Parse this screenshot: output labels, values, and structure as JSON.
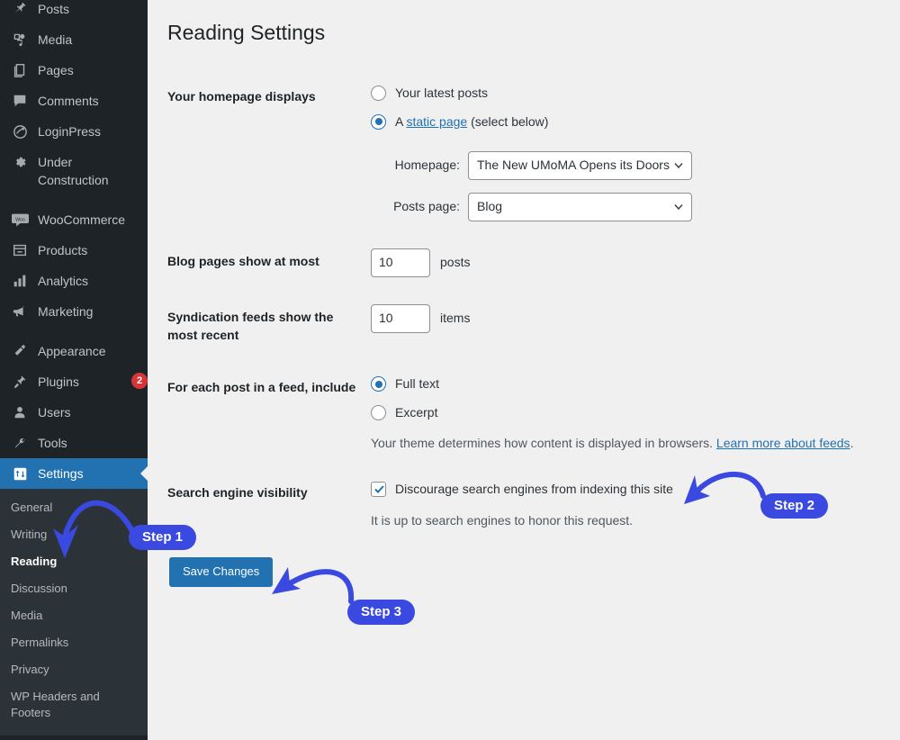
{
  "theme": {
    "sidebar_bg": "#1d2327",
    "submenu_bg": "#2c3338",
    "accent_blue": "#2271b1",
    "annotation_blue": "#3a49e0",
    "badge_red": "#d63638",
    "content_bg": "#f0f0f1"
  },
  "sidebar": {
    "items": [
      {
        "label": "Posts",
        "icon": "pin-icon",
        "active": false
      },
      {
        "label": "Media",
        "icon": "media-icon",
        "active": false
      },
      {
        "label": "Pages",
        "icon": "pages-icon",
        "active": false
      },
      {
        "label": "Comments",
        "icon": "comment-icon",
        "active": false
      },
      {
        "label": "LoginPress",
        "icon": "loginpress-icon",
        "active": false
      },
      {
        "label": "Under Construction",
        "icon": "gear-icon",
        "active": false
      },
      {
        "label": "WooCommerce",
        "icon": "woocommerce-icon",
        "active": false
      },
      {
        "label": "Products",
        "icon": "products-icon",
        "active": false
      },
      {
        "label": "Analytics",
        "icon": "analytics-icon",
        "active": false
      },
      {
        "label": "Marketing",
        "icon": "megaphone-icon",
        "active": false
      },
      {
        "label": "Appearance",
        "icon": "brush-icon",
        "active": false
      },
      {
        "label": "Plugins",
        "icon": "plug-icon",
        "active": false,
        "badge": "2"
      },
      {
        "label": "Users",
        "icon": "user-icon",
        "active": false
      },
      {
        "label": "Tools",
        "icon": "wrench-icon",
        "active": false
      },
      {
        "label": "Settings",
        "icon": "settings-icon",
        "active": true
      }
    ],
    "submenu": [
      {
        "label": "General",
        "current": false
      },
      {
        "label": "Writing",
        "current": false
      },
      {
        "label": "Reading",
        "current": true
      },
      {
        "label": "Discussion",
        "current": false
      },
      {
        "label": "Media",
        "current": false
      },
      {
        "label": "Permalinks",
        "current": false
      },
      {
        "label": "Privacy",
        "current": false
      },
      {
        "label": "WP Headers and Footers",
        "current": false
      }
    ]
  },
  "main": {
    "title": "Reading Settings",
    "homepage": {
      "row_label": "Your homepage displays",
      "option_latest": "Your latest posts",
      "option_static_prefix": "A ",
      "option_static_link": "static page",
      "option_static_suffix": " (select below)",
      "selected": "static_page",
      "homepage_select_label": "Homepage:",
      "homepage_select_value": "The New UMoMA Opens its Doors",
      "posts_select_label": "Posts page:",
      "posts_select_value": "Blog"
    },
    "blog_pages": {
      "row_label": "Blog pages show at most",
      "value": "10",
      "unit": "posts"
    },
    "syndication": {
      "row_label": "Syndication feeds show the most recent",
      "value": "10",
      "unit": "items"
    },
    "feed_include": {
      "row_label": "For each post in a feed, include",
      "option_full": "Full text",
      "option_excerpt": "Excerpt",
      "selected": "full_text",
      "note_text": "Your theme determines how content is displayed in browsers. ",
      "note_link": "Learn more about feeds",
      "note_suffix": "."
    },
    "search_visibility": {
      "row_label": "Search engine visibility",
      "checkbox_label": "Discourage search engines from indexing this site",
      "checked": true,
      "hint": "It is up to search engines to honor this request."
    },
    "save_button": "Save Changes"
  },
  "annotations": {
    "step1": "Step 1",
    "step2": "Step 2",
    "step3": "Step 3"
  }
}
